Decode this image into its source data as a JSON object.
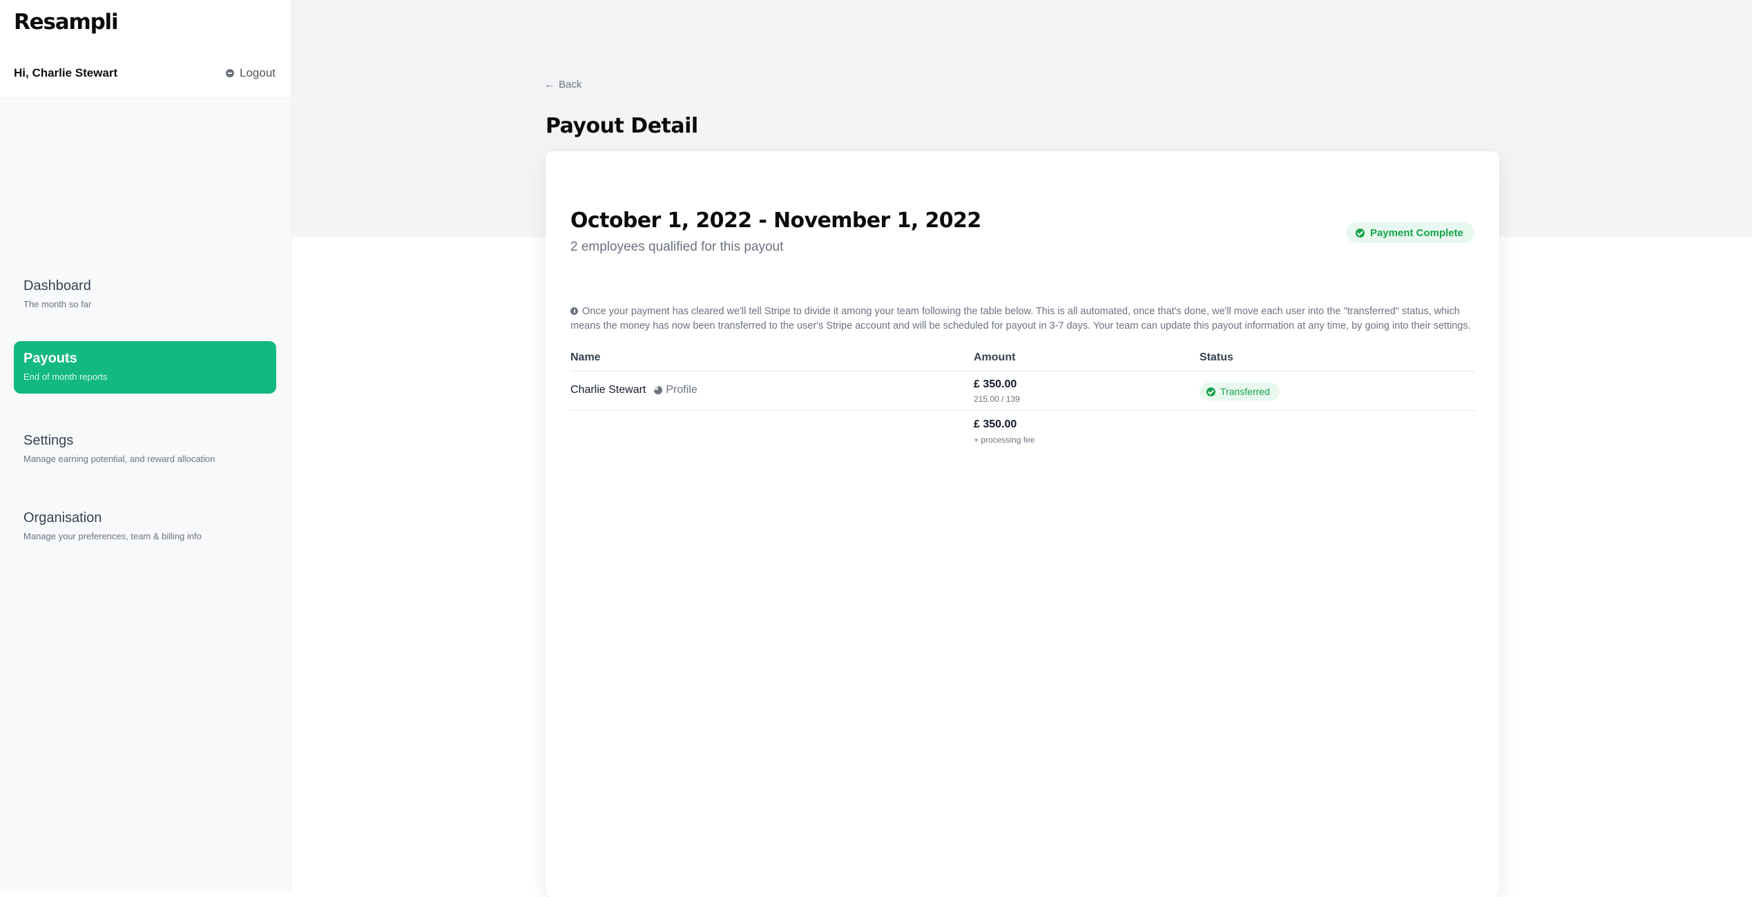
{
  "app": {
    "logo": "Resampli"
  },
  "header": {
    "greeting": "Hi, Charlie Stewart",
    "logout_label": "Logout"
  },
  "sidebar": {
    "items": [
      {
        "label": "Dashboard",
        "sub": "The month so far",
        "active": false
      },
      {
        "label": "Payouts",
        "sub": "End of month reports",
        "active": true
      },
      {
        "label": "Settings",
        "sub": "Manage earning potential, and reward allocation",
        "active": false
      },
      {
        "label": "Organisation",
        "sub": "Manage your preferences, team & billing info",
        "active": false
      }
    ]
  },
  "main": {
    "back_label": "Back",
    "page_title": "Payout Detail",
    "period": "October 1, 2022 - November 1, 2022",
    "qualified": "2 employees qualified for this payout",
    "status_label": "Payment Complete",
    "info_text": "Once your payment has cleared we'll tell Stripe to divide it among your team following the table below. This is all automated, once that's done, we'll move each user into the \"transferred\" status, which means the money has now been transferred to the user's Stripe account and will be scheduled for payout in 3-7 days. Your team can update this payout information at any time, by going into their settings.",
    "table": {
      "columns": [
        "Name",
        "Amount",
        "Status"
      ],
      "rows": [
        {
          "name": "Charlie Stewart",
          "profile_label": "Profile",
          "amount": "£ 350.00",
          "amount_sub": "215.00 / 139",
          "status": "Transferred"
        }
      ],
      "total": "£ 350.00",
      "total_sub": "+ processing fee"
    }
  },
  "colors": {
    "accent": "#13b981",
    "success": "#16a34a",
    "success_bg": "#e8f8ef"
  }
}
